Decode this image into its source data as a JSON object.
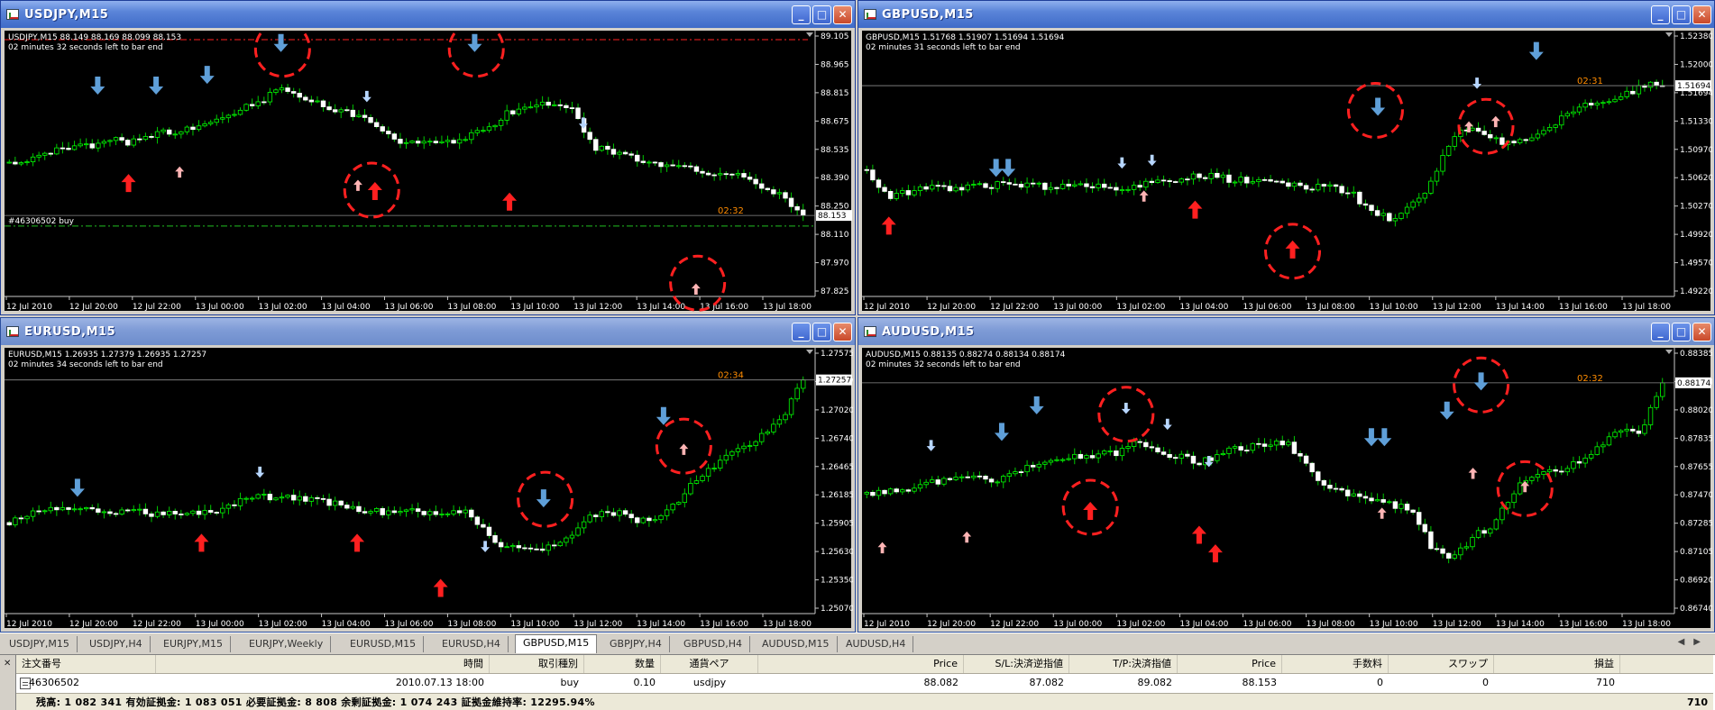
{
  "colors": {
    "chart_bg": "#000000",
    "candle_up": "#00ff00",
    "candle_down": "#ffffff",
    "wick": "#00c800",
    "red_arrow": "#ff2020",
    "pink_arrow": "#ffb4b4",
    "blue_arrow": "#5f9fd8",
    "lightblue_arrow": "#b7d6ff",
    "circle": "#ff2020",
    "bid_line": "#8c8c8c",
    "timer": "#ff8c00",
    "titlebar": "#3f6bc8"
  },
  "windows": [
    {
      "id": "usdjpy",
      "title": "USDJPY,M15",
      "info": "USDJPY,M15  88.149 88.169 88.099 88.153",
      "timer_text": "02 minutes 32 seconds left to bar end",
      "bar_timer": "02:32",
      "price_marker": "88.153",
      "order_label": "#46306502 buy",
      "seed": 11,
      "y_ticks": [
        "89.105",
        "88.965",
        "88.815",
        "88.675",
        "88.535",
        "88.390",
        "88.250",
        "88.110",
        "87.970",
        "87.825"
      ],
      "x_ticks": [
        "12 Jul 2010",
        "12 Jul 20:00",
        "12 Jul 22:00",
        "13 Jul 00:00",
        "13 Jul 02:00",
        "13 Jul 04:00",
        "13 Jul 06:00",
        "13 Jul 08:00",
        "13 Jul 10:00",
        "13 Jul 12:00",
        "13 Jul 14:00",
        "13 Jul 16:00",
        "13 Jul 18:00"
      ],
      "price_path": [
        0.52,
        0.5,
        0.47,
        0.45,
        0.44,
        0.42,
        0.43,
        0.4,
        0.38,
        0.36,
        0.33,
        0.3,
        0.26,
        0.2,
        0.24,
        0.27,
        0.3,
        0.34,
        0.4,
        0.44,
        0.42,
        0.43,
        0.4,
        0.36,
        0.3,
        0.28,
        0.26,
        0.3,
        0.45,
        0.47,
        0.5,
        0.53,
        0.52,
        0.55,
        0.56,
        0.55,
        0.62,
        0.66,
        0.74
      ],
      "markers": [
        {
          "t": "blue",
          "d": "down",
          "x": 0.115,
          "y": 0.21
        },
        {
          "t": "blue",
          "d": "down",
          "x": 0.187,
          "y": 0.21
        },
        {
          "t": "blue",
          "d": "down",
          "x": 0.25,
          "y": 0.17
        },
        {
          "t": "blue",
          "d": "down",
          "x": 0.341,
          "y": 0.05
        },
        {
          "t": "blue",
          "d": "down",
          "x": 0.58,
          "y": 0.05
        },
        {
          "t": "lightblue",
          "d": "down",
          "x": 0.447,
          "y": 0.25
        },
        {
          "t": "lightblue",
          "d": "down",
          "x": 0.714,
          "y": 0.35
        },
        {
          "t": "red",
          "d": "up",
          "x": 0.153,
          "y": 0.57
        },
        {
          "t": "pink",
          "d": "up",
          "x": 0.216,
          "y": 0.53
        },
        {
          "t": "red",
          "d": "up",
          "x": 0.457,
          "y": 0.6
        },
        {
          "t": "pink",
          "d": "up",
          "x": 0.436,
          "y": 0.58
        },
        {
          "t": "red",
          "d": "up",
          "x": 0.623,
          "y": 0.64
        },
        {
          "t": "pink",
          "d": "up",
          "x": 0.853,
          "y": 0.97
        }
      ],
      "circles": [
        {
          "x": 0.343,
          "y": 0.07
        },
        {
          "x": 0.582,
          "y": 0.07
        },
        {
          "x": 0.453,
          "y": 0.6
        },
        {
          "x": 0.855,
          "y": 0.95
        }
      ]
    },
    {
      "id": "gbpusd",
      "title": "GBPUSD,M15",
      "info": "GBPUSD,M15  1.51768 1.51907 1.51694 1.51694",
      "timer_text": "02 minutes 31 seconds left to bar end",
      "bar_timer": "02:31",
      "price_marker": "1.51694",
      "order_label": "",
      "seed": 23,
      "y_ticks": [
        "1.52380",
        "1.52000",
        "1.51694",
        "1.51330",
        "1.50970",
        "1.50620",
        "1.50270",
        "1.49920",
        "1.49570",
        "1.49220"
      ],
      "x_ticks": [
        "12 Jul 2010",
        "12 Jul 20:00",
        "12 Jul 22:00",
        "13 Jul 00:00",
        "13 Jul 02:00",
        "13 Jul 04:00",
        "13 Jul 06:00",
        "13 Jul 08:00",
        "13 Jul 10:00",
        "13 Jul 12:00",
        "13 Jul 14:00",
        "13 Jul 16:00",
        "13 Jul 18:00"
      ],
      "price_path": [
        0.55,
        0.66,
        0.64,
        0.62,
        0.63,
        0.62,
        0.61,
        0.6,
        0.61,
        0.62,
        0.61,
        0.62,
        0.62,
        0.61,
        0.6,
        0.58,
        0.57,
        0.58,
        0.59,
        0.6,
        0.61,
        0.62,
        0.62,
        0.63,
        0.72,
        0.75,
        0.7,
        0.6,
        0.4,
        0.36,
        0.42,
        0.44,
        0.4,
        0.34,
        0.28,
        0.26,
        0.24,
        0.2,
        0.18
      ],
      "markers": [
        {
          "t": "blue",
          "d": "down",
          "x": 0.165,
          "y": 0.52
        },
        {
          "t": "blue",
          "d": "down",
          "x": 0.18,
          "y": 0.52
        },
        {
          "t": "blue",
          "d": "down",
          "x": 0.635,
          "y": 0.29
        },
        {
          "t": "blue",
          "d": "down",
          "x": 0.83,
          "y": 0.08
        },
        {
          "t": "lightblue",
          "d": "down",
          "x": 0.32,
          "y": 0.5
        },
        {
          "t": "lightblue",
          "d": "down",
          "x": 0.357,
          "y": 0.49
        },
        {
          "t": "lightblue",
          "d": "down",
          "x": 0.757,
          "y": 0.2
        },
        {
          "t": "red",
          "d": "up",
          "x": 0.033,
          "y": 0.73
        },
        {
          "t": "pink",
          "d": "up",
          "x": 0.347,
          "y": 0.62
        },
        {
          "t": "red",
          "d": "up",
          "x": 0.41,
          "y": 0.67
        },
        {
          "t": "pink",
          "d": "up",
          "x": 0.747,
          "y": 0.36
        },
        {
          "t": "pink",
          "d": "up",
          "x": 0.78,
          "y": 0.34
        },
        {
          "t": "red",
          "d": "up",
          "x": 0.53,
          "y": 0.82
        }
      ],
      "circles": [
        {
          "x": 0.632,
          "y": 0.3
        },
        {
          "x": 0.53,
          "y": 0.83
        },
        {
          "x": 0.768,
          "y": 0.36
        }
      ]
    },
    {
      "id": "eurusd",
      "title": "EURUSD,M15",
      "info": "EURUSD,M15  1.26935 1.27379 1.26935 1.27257",
      "timer_text": "02 minutes 34 seconds left to bar end",
      "bar_timer": "02:34",
      "price_marker": "1.27257",
      "order_label": "",
      "seed": 37,
      "y_ticks": [
        "1.27575",
        "1.27257",
        "1.27020",
        "1.26740",
        "1.26465",
        "1.26185",
        "1.25905",
        "1.25630",
        "1.25350",
        "1.25070"
      ],
      "x_ticks": [
        "12 Jul 2010",
        "12 Jul 20:00",
        "12 Jul 22:00",
        "13 Jul 00:00",
        "13 Jul 02:00",
        "13 Jul 04:00",
        "13 Jul 06:00",
        "13 Jul 08:00",
        "13 Jul 10:00",
        "13 Jul 12:00",
        "13 Jul 14:00",
        "13 Jul 16:00",
        "13 Jul 18:00"
      ],
      "price_path": [
        0.7,
        0.66,
        0.64,
        0.63,
        0.64,
        0.65,
        0.64,
        0.66,
        0.66,
        0.65,
        0.64,
        0.6,
        0.58,
        0.59,
        0.6,
        0.61,
        0.62,
        0.64,
        0.65,
        0.64,
        0.65,
        0.66,
        0.65,
        0.76,
        0.8,
        0.82,
        0.78,
        0.74,
        0.66,
        0.65,
        0.68,
        0.68,
        0.6,
        0.5,
        0.44,
        0.38,
        0.33,
        0.25,
        0.1
      ],
      "markers": [
        {
          "t": "blue",
          "d": "down",
          "x": 0.09,
          "y": 0.53
        },
        {
          "t": "lightblue",
          "d": "down",
          "x": 0.315,
          "y": 0.47
        },
        {
          "t": "blue",
          "d": "down",
          "x": 0.665,
          "y": 0.57
        },
        {
          "t": "blue",
          "d": "down",
          "x": 0.813,
          "y": 0.26
        },
        {
          "t": "lightblue",
          "d": "down",
          "x": 0.593,
          "y": 0.75
        },
        {
          "t": "red",
          "d": "up",
          "x": 0.243,
          "y": 0.73
        },
        {
          "t": "red",
          "d": "up",
          "x": 0.435,
          "y": 0.73
        },
        {
          "t": "red",
          "d": "up",
          "x": 0.538,
          "y": 0.9
        },
        {
          "t": "pink",
          "d": "up",
          "x": 0.838,
          "y": 0.38
        }
      ],
      "circles": [
        {
          "x": 0.667,
          "y": 0.57
        },
        {
          "x": 0.838,
          "y": 0.37
        }
      ]
    },
    {
      "id": "audusd",
      "title": "AUDUSD,M15",
      "info": "AUDUSD,M15  0.88135 0.88274 0.88134 0.88174",
      "timer_text": "02 minutes 32 seconds left to bar end",
      "bar_timer": "02:32",
      "price_marker": "0.88174",
      "order_label": "",
      "seed": 53,
      "y_ticks": [
        "0.88385",
        "0.88174",
        "0.88020",
        "0.87835",
        "0.87655",
        "0.87470",
        "0.87285",
        "0.87105",
        "0.86920",
        "0.86740"
      ],
      "x_ticks": [
        "12 Jul 2010",
        "12 Jul 20:00",
        "12 Jul 22:00",
        "13 Jul 00:00",
        "13 Jul 02:00",
        "13 Jul 04:00",
        "13 Jul 06:00",
        "13 Jul 08:00",
        "13 Jul 10:00",
        "13 Jul 12:00",
        "13 Jul 14:00",
        "13 Jul 16:00",
        "13 Jul 18:00"
      ],
      "price_path": [
        0.58,
        0.56,
        0.55,
        0.53,
        0.52,
        0.5,
        0.52,
        0.48,
        0.46,
        0.44,
        0.42,
        0.41,
        0.4,
        0.36,
        0.4,
        0.42,
        0.44,
        0.4,
        0.38,
        0.37,
        0.36,
        0.45,
        0.55,
        0.58,
        0.6,
        0.62,
        0.64,
        0.8,
        0.85,
        0.75,
        0.7,
        0.55,
        0.5,
        0.48,
        0.44,
        0.38,
        0.3,
        0.32,
        0.1
      ],
      "markers": [
        {
          "t": "lightblue",
          "d": "down",
          "x": 0.085,
          "y": 0.37
        },
        {
          "t": "blue",
          "d": "down",
          "x": 0.172,
          "y": 0.32
        },
        {
          "t": "blue",
          "d": "down",
          "x": 0.215,
          "y": 0.22
        },
        {
          "t": "lightblue",
          "d": "down",
          "x": 0.325,
          "y": 0.23
        },
        {
          "t": "lightblue",
          "d": "down",
          "x": 0.376,
          "y": 0.29
        },
        {
          "t": "lightblue",
          "d": "down",
          "x": 0.427,
          "y": 0.43
        },
        {
          "t": "blue",
          "d": "down",
          "x": 0.627,
          "y": 0.34
        },
        {
          "t": "blue",
          "d": "down",
          "x": 0.643,
          "y": 0.34
        },
        {
          "t": "blue",
          "d": "down",
          "x": 0.72,
          "y": 0.24
        },
        {
          "t": "blue",
          "d": "down",
          "x": 0.762,
          "y": 0.13
        },
        {
          "t": "pink",
          "d": "up",
          "x": 0.025,
          "y": 0.75
        },
        {
          "t": "pink",
          "d": "up",
          "x": 0.129,
          "y": 0.71
        },
        {
          "t": "red",
          "d": "up",
          "x": 0.281,
          "y": 0.61
        },
        {
          "t": "red",
          "d": "up",
          "x": 0.415,
          "y": 0.7
        },
        {
          "t": "red",
          "d": "up",
          "x": 0.435,
          "y": 0.77
        },
        {
          "t": "pink",
          "d": "up",
          "x": 0.64,
          "y": 0.62
        },
        {
          "t": "pink",
          "d": "up",
          "x": 0.752,
          "y": 0.47
        },
        {
          "t": "pink",
          "d": "up",
          "x": 0.816,
          "y": 0.52
        }
      ],
      "circles": [
        {
          "x": 0.325,
          "y": 0.25
        },
        {
          "x": 0.281,
          "y": 0.6
        },
        {
          "x": 0.762,
          "y": 0.14
        },
        {
          "x": 0.816,
          "y": 0.53
        }
      ]
    }
  ],
  "symbol_tabs": [
    "USDJPY,M15",
    "USDJPY,H4",
    "EURJPY,M15",
    "EURJPY,Weekly",
    "EURUSD,M15",
    "EURUSD,H4",
    "GBPUSD,M15",
    "GBPJPY,H4",
    "GBPUSD,H4",
    "AUDUSD,M15",
    "AUDUSD,H4"
  ],
  "active_tab": "GBPUSD,M15",
  "terminal": {
    "headers": [
      "注文番号",
      "時間",
      "取引種別",
      "数量",
      "通貨ペア",
      "Price",
      "S/L:決済逆指値",
      "T/P:決済指値",
      "Price",
      "手数料",
      "スワップ",
      "損益"
    ],
    "row": [
      "46306502",
      "2010.07.13 18:00",
      "buy",
      "0.10",
      "usdjpy",
      "88.082",
      "87.082",
      "89.082",
      "88.153",
      "0",
      "0",
      "710"
    ],
    "balance_text": "残高: 1 082 341   有効証拠金: 1 083 051   必要証拠金: 8 808   余剰証拠金: 1 074 243   証拠金維持率: 12295.94%",
    "balance_profit": "710"
  }
}
